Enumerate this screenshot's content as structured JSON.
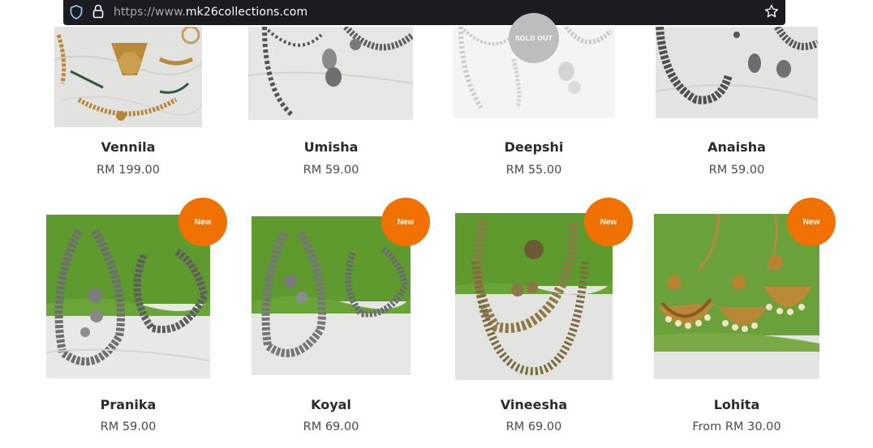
{
  "browser": {
    "url_prefix": "https://www.",
    "url_domain": "mk26collections.com"
  },
  "products": [
    {
      "name": "Vennila",
      "price": "RM 199.00"
    },
    {
      "name": "Umisha",
      "price": "RM 59.00"
    },
    {
      "name": "Deepshi",
      "price": "RM 55.00",
      "badge": "SOLD OUT"
    },
    {
      "name": "Anaisha",
      "price": "RM 59.00"
    },
    {
      "name": "Pranika",
      "price": "RM 59.00",
      "badge": "New"
    },
    {
      "name": "Koyal",
      "price": "RM 69.00",
      "badge": "New"
    },
    {
      "name": "Vineesha",
      "price": "RM 69.00",
      "badge": "New"
    },
    {
      "name": "Lohita",
      "price": "From RM 30.00",
      "badge": "New"
    }
  ],
  "colors": {
    "badge_new": "#f07000",
    "badge_sold_out": "#bdbdbd",
    "fabric_green": "#5f9a2e"
  }
}
